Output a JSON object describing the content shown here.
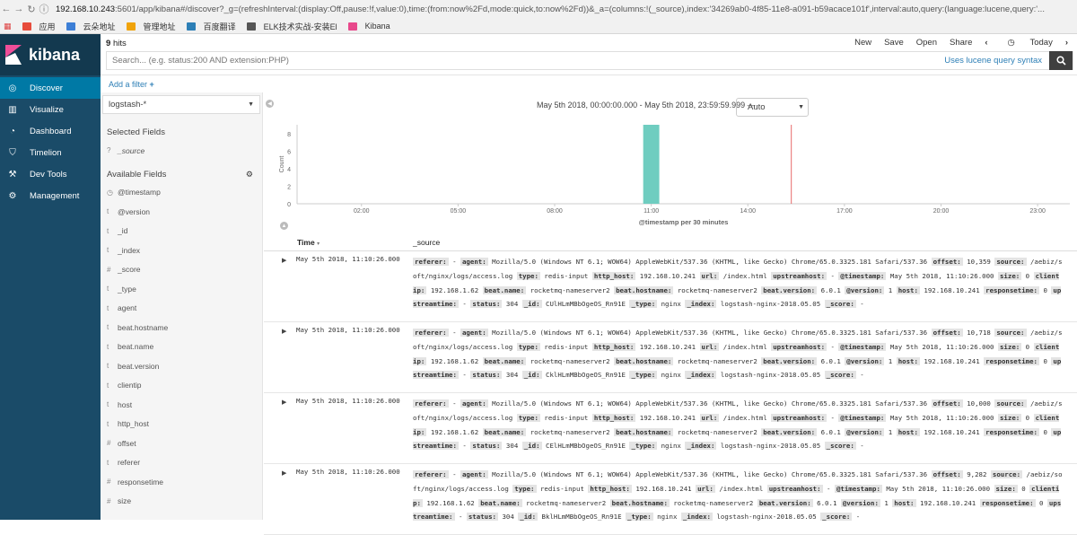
{
  "browser": {
    "url_host": "192.168.10.243",
    "url_rest": ":5601/app/kibana#/discover?_g=(refreshInterval:(display:Off,pause:!f,value:0),time:(from:now%2Fd,mode:quick,to:now%2Fd))&_a=(columns:!(_source),index:'34269ab0-4f85-11e8-a091-b59acace101f',interval:auto,query:(language:lucene,query:'...",
    "bookmarks": [
      "应用",
      "云朵地址",
      "管理地址",
      "百度翻译",
      "ELK技术实战-安装El",
      "Kibana"
    ],
    "bookmark_colors": [
      "#e74c3c",
      "#3d7fd6",
      "#f0a30a",
      "#2d7fb6",
      "#555555",
      "#e8488b"
    ]
  },
  "sidebar": {
    "brand": "kibana",
    "items": [
      {
        "label": "Discover",
        "icon": "compass-icon"
      },
      {
        "label": "Visualize",
        "icon": "bar-chart-icon"
      },
      {
        "label": "Dashboard",
        "icon": "dashboard-icon"
      },
      {
        "label": "Timelion",
        "icon": "shield-icon"
      },
      {
        "label": "Dev Tools",
        "icon": "wrench-icon"
      },
      {
        "label": "Management",
        "icon": "gear-icon"
      }
    ],
    "active_color": "#0079a5"
  },
  "topbar": {
    "hits_count": "9",
    "hits_label": "hits",
    "menu": {
      "new": "New",
      "save": "Save",
      "open": "Open",
      "share": "Share",
      "today": "Today"
    },
    "search_placeholder": "Search... (e.g. status:200 AND extension:PHP)",
    "lucene_link": "Uses lucene query syntax"
  },
  "filter": {
    "add": "Add a filter"
  },
  "fields_panel": {
    "index_pattern": "logstash-*",
    "selected_title": "Selected Fields",
    "selected": [
      {
        "type": "?",
        "name": "_source"
      }
    ],
    "available_title": "Available Fields",
    "available": [
      {
        "type": "◷",
        "name": "@timestamp"
      },
      {
        "type": "t",
        "name": "@version"
      },
      {
        "type": "t",
        "name": "_id"
      },
      {
        "type": "t",
        "name": "_index"
      },
      {
        "type": "#",
        "name": "_score"
      },
      {
        "type": "t",
        "name": "_type"
      },
      {
        "type": "t",
        "name": "agent"
      },
      {
        "type": "t",
        "name": "beat.hostname"
      },
      {
        "type": "t",
        "name": "beat.name"
      },
      {
        "type": "t",
        "name": "beat.version"
      },
      {
        "type": "t",
        "name": "clientip"
      },
      {
        "type": "t",
        "name": "host"
      },
      {
        "type": "t",
        "name": "http_host"
      },
      {
        "type": "#",
        "name": "offset"
      },
      {
        "type": "t",
        "name": "referer"
      },
      {
        "type": "#",
        "name": "responsetime"
      },
      {
        "type": "#",
        "name": "size"
      }
    ]
  },
  "chart": {
    "date_range": "May 5th 2018, 00:00:00.000 - May 5th 2018, 23:59:59.999 —",
    "interval": "Auto"
  },
  "chart_data": {
    "type": "bar",
    "x": [
      "02:00",
      "05:00",
      "08:00",
      "11:00",
      "14:00",
      "17:00",
      "20:00",
      "23:00"
    ],
    "series": [
      {
        "values": [
          {
            "x": "11:00",
            "y": 9
          }
        ]
      }
    ],
    "xlabel": "@timestamp per 30 minutes",
    "ylabel": "Count",
    "yticks": [
      "0",
      "2",
      "4",
      "6",
      "8"
    ],
    "ylim": [
      0,
      9
    ],
    "xlim_hours": [
      0,
      24
    ],
    "bar_hour": 11,
    "now_marker_hour": 15.35,
    "bar_color": "#6fcdc0",
    "marker_color": "#e86b6b"
  },
  "table": {
    "headers": [
      "Time",
      "_source"
    ],
    "rows": [
      {
        "time": "May 5th 2018, 11:10:26.000",
        "fields": [
          [
            "referer:",
            "-"
          ],
          [
            "agent:",
            "Mozilla/5.0 (Windows NT 6.1; WOW64) AppleWebKit/537.36 (KHTML, like Gecko) Chrome/65.0.3325.181 Safari/537.36"
          ],
          [
            "offset:",
            "10,359"
          ],
          [
            "source:",
            "/aebiz/soft/nginx/logs/access.log"
          ],
          [
            "type:",
            "redis-input"
          ],
          [
            "http_host:",
            "192.168.10.241"
          ],
          [
            "url:",
            "/index.html"
          ],
          [
            "upstreamhost:",
            "-"
          ],
          [
            "@timestamp:",
            "May 5th 2018, 11:10:26.000"
          ],
          [
            "size:",
            "0"
          ],
          [
            "clientip:",
            "192.168.1.62"
          ],
          [
            "beat.name:",
            "rocketmq-nameserver2"
          ],
          [
            "beat.hostname:",
            "rocketmq-nameserver2"
          ],
          [
            "beat.version:",
            "6.0.1"
          ],
          [
            "@version:",
            "1"
          ],
          [
            "host:",
            "192.168.10.241"
          ],
          [
            "responsetime:",
            "0"
          ],
          [
            "upstreamtime:",
            "-"
          ],
          [
            "status:",
            "304"
          ],
          [
            "_id:",
            "CUlHLmMBbOgeOS_Rn91E"
          ],
          [
            "_type:",
            "nginx"
          ],
          [
            "_index:",
            "logstash-nginx-2018.05.05"
          ],
          [
            "_score:",
            "-"
          ]
        ]
      },
      {
        "time": "May 5th 2018, 11:10:26.000",
        "fields": [
          [
            "referer:",
            "-"
          ],
          [
            "agent:",
            "Mozilla/5.0 (Windows NT 6.1; WOW64) AppleWebKit/537.36 (KHTML, like Gecko) Chrome/65.0.3325.181 Safari/537.36"
          ],
          [
            "offset:",
            "10,718"
          ],
          [
            "source:",
            "/aebiz/soft/nginx/logs/access.log"
          ],
          [
            "type:",
            "redis-input"
          ],
          [
            "http_host:",
            "192.168.10.241"
          ],
          [
            "url:",
            "/index.html"
          ],
          [
            "upstreamhost:",
            "-"
          ],
          [
            "@timestamp:",
            "May 5th 2018, 11:10:26.000"
          ],
          [
            "size:",
            "0"
          ],
          [
            "clientip:",
            "192.168.1.62"
          ],
          [
            "beat.name:",
            "rocketmq-nameserver2"
          ],
          [
            "beat.hostname:",
            "rocketmq-nameserver2"
          ],
          [
            "beat.version:",
            "6.0.1"
          ],
          [
            "@version:",
            "1"
          ],
          [
            "host:",
            "192.168.10.241"
          ],
          [
            "responsetime:",
            "0"
          ],
          [
            "upstreamtime:",
            "-"
          ],
          [
            "status:",
            "304"
          ],
          [
            "_id:",
            "CklHLmMBbOgeOS_Rn91E"
          ],
          [
            "_type:",
            "nginx"
          ],
          [
            "_index:",
            "logstash-nginx-2018.05.05"
          ],
          [
            "_score:",
            "-"
          ]
        ]
      },
      {
        "time": "May 5th 2018, 11:10:26.000",
        "fields": [
          [
            "referer:",
            "-"
          ],
          [
            "agent:",
            "Mozilla/5.0 (Windows NT 6.1; WOW64) AppleWebKit/537.36 (KHTML, like Gecko) Chrome/65.0.3325.181 Safari/537.36"
          ],
          [
            "offset:",
            "10,000"
          ],
          [
            "source:",
            "/aebiz/soft/nginx/logs/access.log"
          ],
          [
            "type:",
            "redis-input"
          ],
          [
            "http_host:",
            "192.168.10.241"
          ],
          [
            "url:",
            "/index.html"
          ],
          [
            "upstreamhost:",
            "-"
          ],
          [
            "@timestamp:",
            "May 5th 2018, 11:10:26.000"
          ],
          [
            "size:",
            "0"
          ],
          [
            "clientip:",
            "192.168.1.62"
          ],
          [
            "beat.name:",
            "rocketmq-nameserver2"
          ],
          [
            "beat.hostname:",
            "rocketmq-nameserver2"
          ],
          [
            "beat.version:",
            "6.0.1"
          ],
          [
            "@version:",
            "1"
          ],
          [
            "host:",
            "192.168.10.241"
          ],
          [
            "responsetime:",
            "0"
          ],
          [
            "upstreamtime:",
            "-"
          ],
          [
            "status:",
            "304"
          ],
          [
            "_id:",
            "CElHLmMBbOgeOS_Rn91E"
          ],
          [
            "_type:",
            "nginx"
          ],
          [
            "_index:",
            "logstash-nginx-2018.05.05"
          ],
          [
            "_score:",
            "-"
          ]
        ]
      },
      {
        "time": "May 5th 2018, 11:10:26.000",
        "fields": [
          [
            "referer:",
            "-"
          ],
          [
            "agent:",
            "Mozilla/5.0 (Windows NT 6.1; WOW64) AppleWebKit/537.36 (KHTML, like Gecko) Chrome/65.0.3325.181 Safari/537.36"
          ],
          [
            "offset:",
            "9,282"
          ],
          [
            "source:",
            "/aebiz/soft/nginx/logs/access.log"
          ],
          [
            "type:",
            "redis-input"
          ],
          [
            "http_host:",
            "192.168.10.241"
          ],
          [
            "url:",
            "/index.html"
          ],
          [
            "upstreamhost:",
            "-"
          ],
          [
            "@timestamp:",
            "May 5th 2018, 11:10:26.000"
          ],
          [
            "size:",
            "0"
          ],
          [
            "clientip:",
            "192.168.1.62"
          ],
          [
            "beat.name:",
            "rocketmq-nameserver2"
          ],
          [
            "beat.hostname:",
            "rocketmq-nameserver2"
          ],
          [
            "beat.version:",
            "6.0.1"
          ],
          [
            "@version:",
            "1"
          ],
          [
            "host:",
            "192.168.10.241"
          ],
          [
            "responsetime:",
            "0"
          ],
          [
            "upstreamtime:",
            "-"
          ],
          [
            "status:",
            "304"
          ],
          [
            "_id:",
            "BklHLmMBbOgeOS_Rn91E"
          ],
          [
            "_type:",
            "nginx"
          ],
          [
            "_index:",
            "logstash-nginx-2018.05.05"
          ],
          [
            "_score:",
            "-"
          ]
        ]
      }
    ]
  }
}
